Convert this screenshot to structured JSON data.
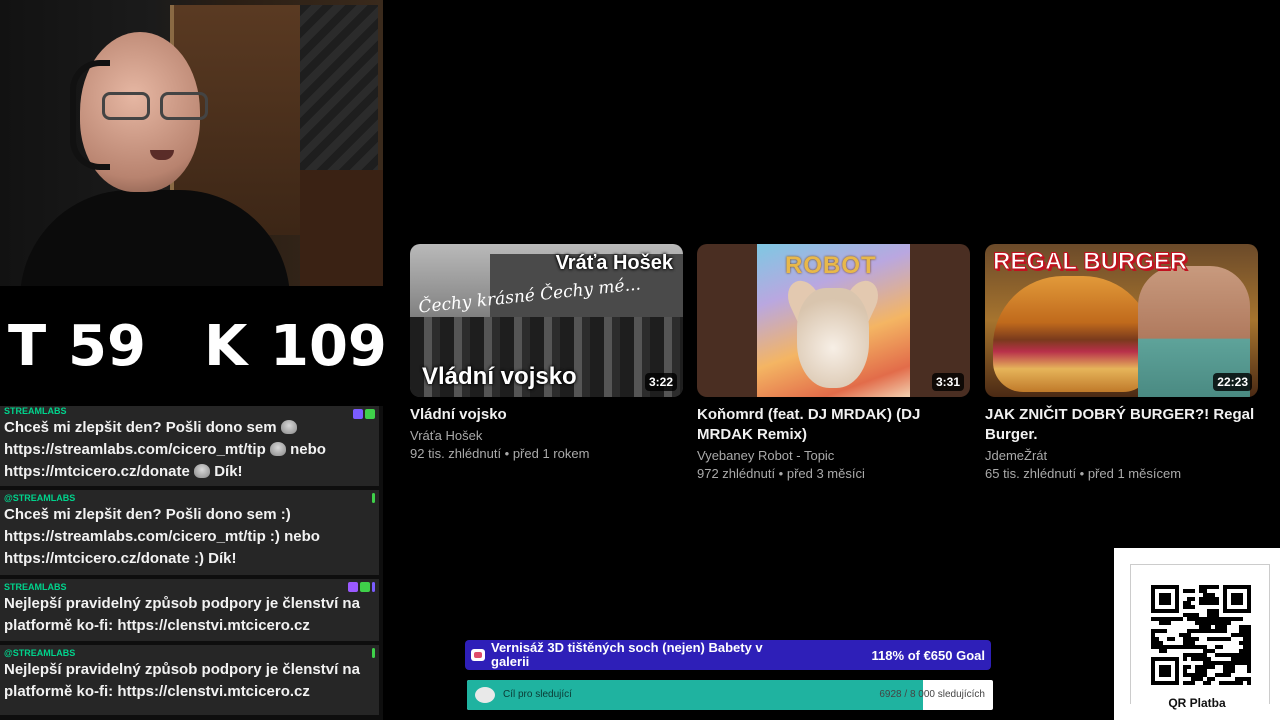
{
  "score": {
    "t_label": "T",
    "t_value": "59",
    "k_label": "K",
    "k_value": "109"
  },
  "chat": [
    {
      "user": "STREAMLABS",
      "parts": [
        "Chceš mi zlepšit den? Pošli dono sem ",
        "emote",
        " https://streamlabs.com/cicero_mt/tip ",
        "emote",
        " nebo https://mtcicero.cz/donate ",
        "emote",
        " Dík!"
      ]
    },
    {
      "user": "@STREAMLABS",
      "text": "Chceš mi zlepšit den? Pošli dono sem :) https://streamlabs.com/cicero_mt/tip :) nebo https://mtcicero.cz/donate :) Dík!"
    },
    {
      "user": "STREAMLABS",
      "text": "Nejlepší pravidelný způsob podpory je členství na platformě ko-fi: https://clenstvi.mtcicero.cz"
    },
    {
      "user": "@STREAMLABS",
      "text": "Nejlepší pravidelný způsob podpory je členství na platformě ko-fi: https://clenstvi.mtcicero.cz"
    }
  ],
  "videos": [
    {
      "title": "Vládní vojsko",
      "channel": "Vráťa Hošek",
      "meta": "92 tis. zhlédnutí • před 1 rokem",
      "duration": "3:22",
      "thumb_text_top": "Vráťa Hošek",
      "thumb_text_bottom": "Vládní vojsko",
      "thumb_script": "Čechy krásné Čechy mé..."
    },
    {
      "title": "Koňomrd (feat. DJ MRDAK) (DJ MRDAK Remix)",
      "channel": "Vyebaney Robot - Topic",
      "meta": "972 zhlédnutí • před 3 měsíci",
      "duration": "3:31",
      "thumb_text_top": "ROBOT"
    },
    {
      "title": "JAK ZNIČIT DOBRÝ BURGER?! Regal Burger.",
      "channel": "JdemeŽrát",
      "meta": "65 tis. zhlédnutí • před 1 měsícem",
      "duration": "22:23",
      "thumb_text_top": "REGAL BURGER"
    }
  ],
  "goal_donation": {
    "title": "Vernisáž 3D tištěných soch (nejen) Babety v galerii",
    "progress": "118% of €650 Goal",
    "color": "#2e1fb8"
  },
  "goal_follow": {
    "label": "Cíl pro sledující",
    "count": "6928 / 8 000 sledujících",
    "fraction": 0.866,
    "color": "#1fb3a0"
  },
  "qr": {
    "label": "QR Platba"
  }
}
